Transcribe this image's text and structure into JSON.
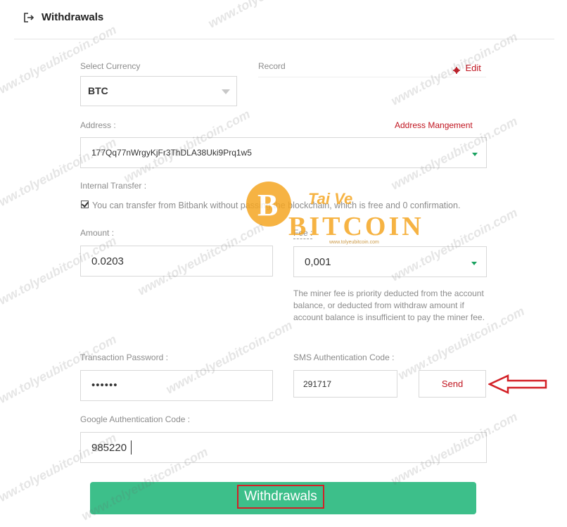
{
  "header": {
    "title": "Withdrawals",
    "icon": "logout-icon"
  },
  "currency": {
    "label": "Select Currency",
    "value": "BTC"
  },
  "record": {
    "label": "Record",
    "edit_label": "Edit",
    "edit_icon": "gear-icon"
  },
  "address": {
    "label": "Address :",
    "management_link": "Address Mangement",
    "value": "177Qq77nWrgyKjFr3ThDLA38Uki9Prq1w5"
  },
  "internal_transfer": {
    "label": "Internal Transfer :",
    "checked": true,
    "description": "You can transfer from Bitbank without passing the blockchain, which is free and 0 confirmation."
  },
  "amount": {
    "label": "Amount :",
    "value": "0.0203"
  },
  "fee": {
    "label": "Fee :",
    "value": "0,001",
    "note": "The miner fee is priority deducted from the account balance, or deducted from withdraw amount if account balance is insufficient to pay the miner fee."
  },
  "transaction_password": {
    "label": "Transaction Password :",
    "value": "••••••"
  },
  "sms_code": {
    "label": "SMS Authentication Code :",
    "value": "291717",
    "send_label": "Send"
  },
  "google_code": {
    "label": "Google Authentication Code :",
    "value": "985220"
  },
  "submit": {
    "label": "Withdrawals"
  },
  "watermark": {
    "logo_main": "BITCOIN",
    "logo_sub": "Tai Ve",
    "url": "www.tolyeubitcoin.com",
    "repeat_text": "www.tolyeubitcoin.com"
  },
  "colors": {
    "accent_green": "#3dbf8a",
    "dropdown_green": "#1aa260",
    "link_red": "#c0141f",
    "highlight_red": "#d32026",
    "logo_orange": "#f5a623"
  }
}
